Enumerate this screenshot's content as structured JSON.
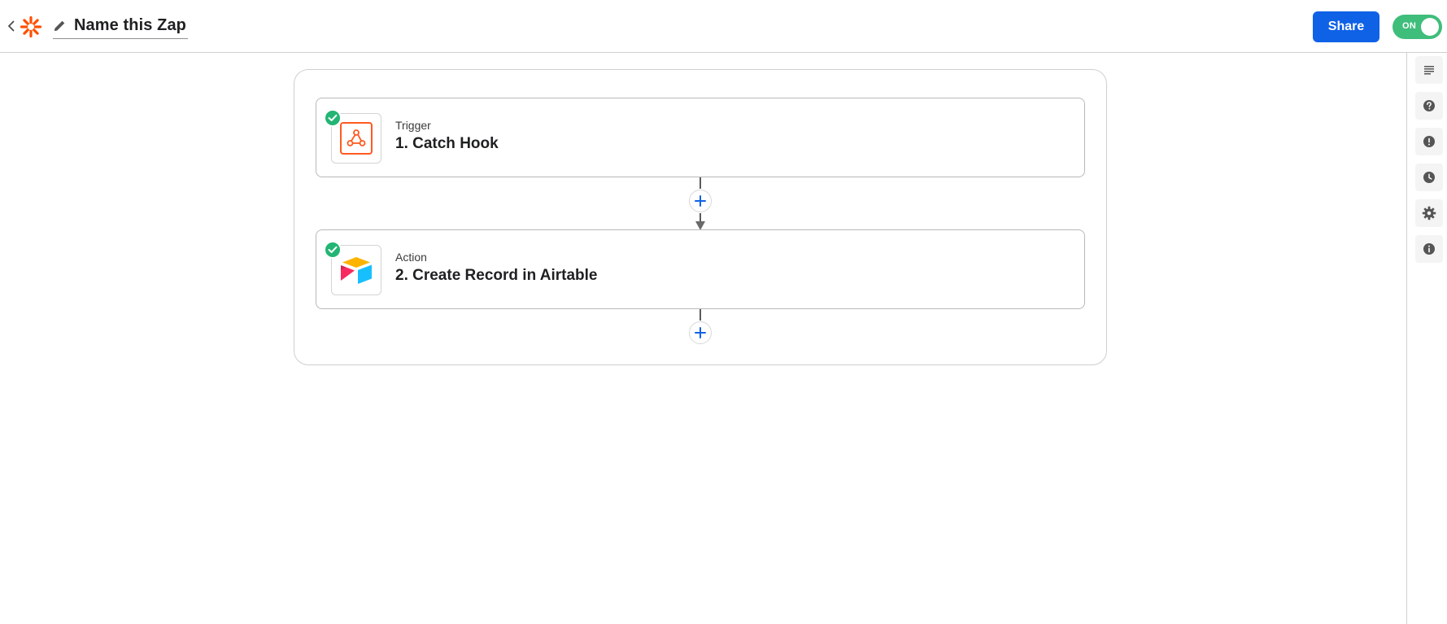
{
  "header": {
    "back_icon": "chevron-left-icon",
    "logo_icon": "zapier-logo-icon",
    "edit_icon": "pencil-icon",
    "zap_name": "Name this Zap",
    "share_label": "Share",
    "toggle_label": "ON",
    "toggle_on": true
  },
  "steps": [
    {
      "type": "Trigger",
      "title": "1. Catch Hook",
      "app_icon": "webhook-icon",
      "status_icon": "check-icon"
    },
    {
      "type": "Action",
      "title": "2. Create Record in Airtable",
      "app_icon": "airtable-icon",
      "status_icon": "check-icon"
    }
  ],
  "add_step_icon": "plus-icon",
  "right_rail": {
    "items": [
      {
        "icon": "notes-icon"
      },
      {
        "icon": "help-icon"
      },
      {
        "icon": "alert-icon"
      },
      {
        "icon": "history-icon"
      },
      {
        "icon": "settings-icon"
      },
      {
        "icon": "info-icon"
      }
    ]
  },
  "colors": {
    "accent": "#0f62e6",
    "toggle_on": "#3fbd7b",
    "check": "#22b573",
    "brand": "#ff4f00"
  }
}
